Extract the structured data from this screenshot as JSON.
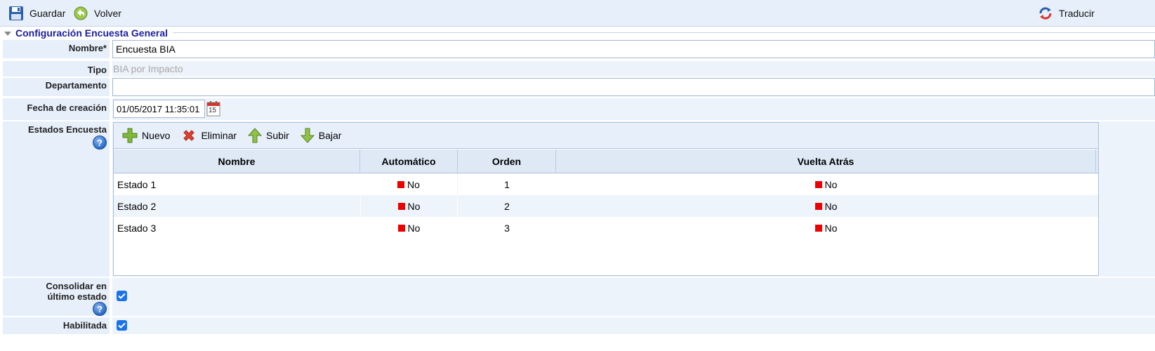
{
  "toolbar": {
    "save_label": "Guardar",
    "back_label": "Volver",
    "translate_label": "Traducir"
  },
  "section": {
    "legend": "Configuración Encuesta General"
  },
  "form": {
    "nombre_label": "Nombre*",
    "nombre_value": "Encuesta BIA",
    "tipo_label": "Tipo",
    "tipo_value": "BIA por Impacto",
    "departamento_label": "Departamento",
    "departamento_value": "",
    "fecha_label": "Fecha de creación",
    "fecha_value": "01/05/2017 11:35:01",
    "calendar_day": "15",
    "estados_label": "Estados Encuesta",
    "consolidar_label": "Consolidar en último estado",
    "consolidar_checked": true,
    "habilitada_label": "Habilitada",
    "habilitada_checked": true
  },
  "grid": {
    "toolbar": {
      "new_label": "Nuevo",
      "delete_label": "Eliminar",
      "up_label": "Subir",
      "down_label": "Bajar"
    },
    "columns": [
      "Nombre",
      "Automático",
      "Orden",
      "Vuelta Atrás"
    ],
    "rows": [
      {
        "nombre": "Estado 1",
        "automatico": "No",
        "orden": "1",
        "vuelta": "No"
      },
      {
        "nombre": "Estado 2",
        "automatico": "No",
        "orden": "2",
        "vuelta": "No"
      },
      {
        "nombre": "Estado 3",
        "automatico": "No",
        "orden": "3",
        "vuelta": "No"
      }
    ]
  },
  "colors": {
    "legend_text": "#1a1f9a",
    "label_bg": "#e7effa",
    "flag_no": "#ee0000",
    "checkbox": "#1a73e8"
  },
  "icons": {
    "save": "floppy-disk-icon",
    "back": "back-arrow-icon",
    "translate": "refresh-icon",
    "calendar": "calendar-icon",
    "help": "help-icon",
    "new": "plus-icon",
    "delete": "x-icon",
    "up": "arrow-up-icon",
    "down": "arrow-down-icon"
  }
}
